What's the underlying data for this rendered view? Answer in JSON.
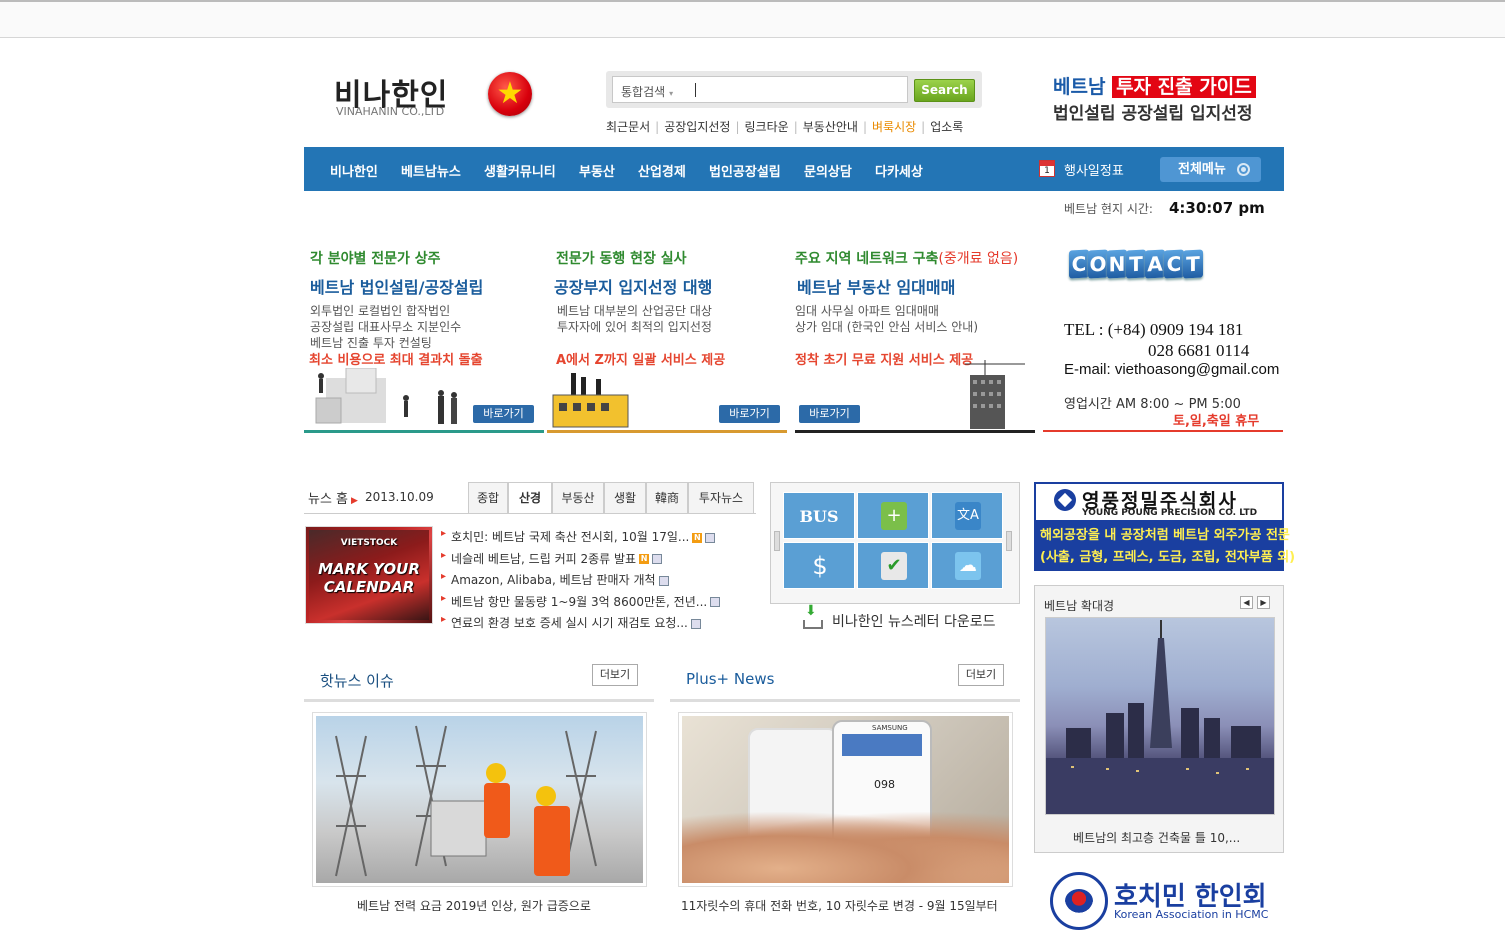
{
  "header": {
    "logo_ko": "비나한인",
    "logo_en": "VINAHANIN CO.,LTD",
    "flag_star": "★",
    "search_select": "통합검색",
    "search_arrow": "▾",
    "search_button": "Search",
    "quick_links": [
      "최근문서",
      "공장입지선정",
      "링크타운",
      "부동산안내",
      "벼룩시장",
      "업소록"
    ],
    "ad_line1_a": "베트남",
    "ad_line1_b": "투자 진출 가이드",
    "ad_line2": "법인설립 공장설립 입지선정"
  },
  "nav": {
    "items": [
      "비나한인",
      "베트남뉴스",
      "생활커뮤니티",
      "부동산",
      "산업경제",
      "법인공장설립",
      "문의상담",
      "다카세상"
    ],
    "calendar_day": "1",
    "schedule": "행사일정표",
    "all_menu": "전체메뉴"
  },
  "time": {
    "label": "베트남 현지 시간:",
    "value": "4:30:07 pm"
  },
  "promos": [
    {
      "h1": "각 분야별 전문가 상주",
      "h1_extra": "",
      "h2": "베트남 법인설립/공장설립",
      "desc": [
        "외투법인 로컬법인 합작법인",
        "공장설립 대표사무소 지분인수",
        "베트남 진출 투자 컨설팅"
      ],
      "red": "최소 비용으로 최대 결과치 돌출",
      "btn": "바로가기",
      "line_color": "#2a9a8a"
    },
    {
      "h1": "전문가 동행 현장 실사",
      "h1_extra": "",
      "h2": "공장부지 입지선정 대행",
      "desc": [
        "베트남 대부분의 산업공단 대상",
        "투자자에 있어 최적의 입지선정"
      ],
      "red": "A에서 Z까지 일괄 서비스 제공",
      "btn": "바로가기",
      "line_color": "#d89a30"
    },
    {
      "h1": "주요 지역 네트워크 구축",
      "h1_extra": "(중개료 없음)",
      "h2": "베트남 부동산 임대매매",
      "desc": [
        "임대 사무실 아파트 임대매매",
        "상가 임대 (한국인 안심 서비스 안내)"
      ],
      "red": "정착 초기 무료 지원 서비스 제공",
      "btn": "바로가기",
      "line_color": "#222222"
    }
  ],
  "contact": {
    "letters": [
      "C",
      "O",
      "N",
      "T",
      "A",
      "C",
      "T"
    ],
    "tel1": "TEL : (+84) 0909 194 181",
    "tel2": "028 6681 0114",
    "email": "E-mail: viethoasong@gmail.com",
    "hours": "영업시간 AM 8:00 ~ PM 5:00",
    "holiday": "토,일,축일 휴무"
  },
  "news": {
    "home": "뉴스 홈",
    "date": "2013.10.09",
    "tabs": [
      "종합",
      "산경",
      "부동산",
      "생활",
      "韓商",
      "투자뉴스"
    ],
    "active_tab": "산경",
    "thumb_top": "VIETSTOCK",
    "thumb_text1": "MARK YOUR",
    "thumb_text2": "CALENDAR",
    "items": [
      {
        "text": "호치민: 베트남 국제 축산 전시회, 10월 17일...",
        "new": "N"
      },
      {
        "text": "네슬레 베트남, 드립 커피 2종류 발표",
        "new": "N"
      },
      {
        "text": "Amazon, Alibaba, 베트남 판매자 개척",
        "new": ""
      },
      {
        "text": "베트남 항만 물동량 1~9월 3억 8600만톤, 전년...",
        "new": ""
      },
      {
        "text": "연료의 환경 보호 증세 실시 시기 재검토 요청...",
        "new": ""
      }
    ]
  },
  "quick_icons": {
    "bus": "BUS",
    "icons": [
      "map-add-icon",
      "translate-icon",
      "dollar-icon",
      "checklist-icon",
      "cloud-icon"
    ],
    "translate_glyph": "文A",
    "dollar_glyph": "$",
    "check_glyph": "✔",
    "cloud_glyph": "☁",
    "map_glyph": "+"
  },
  "newsletter": "비나한인 뉴스레터 다운로드",
  "hotnews": {
    "title": "핫뉴스 이슈",
    "more": "더보기",
    "caption": "베트남 전력 요금 2019년 인상, 원가 급증으로"
  },
  "plusnews": {
    "title": "Plus+ News",
    "more": "더보기",
    "caption": "11자릿수의 휴대 전화 번호, 10 자릿수로 변경 - 9월 15일부터",
    "phone_display": "098",
    "phone_brand": "SAMSUNG"
  },
  "ad_right": {
    "company": "영풍정밀주식회사",
    "company_en": "YOUNG POUNG PRECISION CO. LTD",
    "line1": "해외공장을 내 공장처럼 베트남 외주가공 전문",
    "line2": "(사출, 금형, 프레스, 도금, 조립, 전자부품 외)"
  },
  "enlarge": {
    "title": "베트남 확대경",
    "prev": "◀",
    "next": "▶",
    "caption": "베트남의 최고층 건축물 틀 10,..."
  },
  "hcmc": {
    "name_ko": "호치민 한인회",
    "name_en": "Korean Association in HCMC"
  },
  "colors": {
    "nav_bg": "#2375b5",
    "accent_red": "#e53b2c",
    "green": "#2f8a2f",
    "blue": "#1a5c9c"
  }
}
